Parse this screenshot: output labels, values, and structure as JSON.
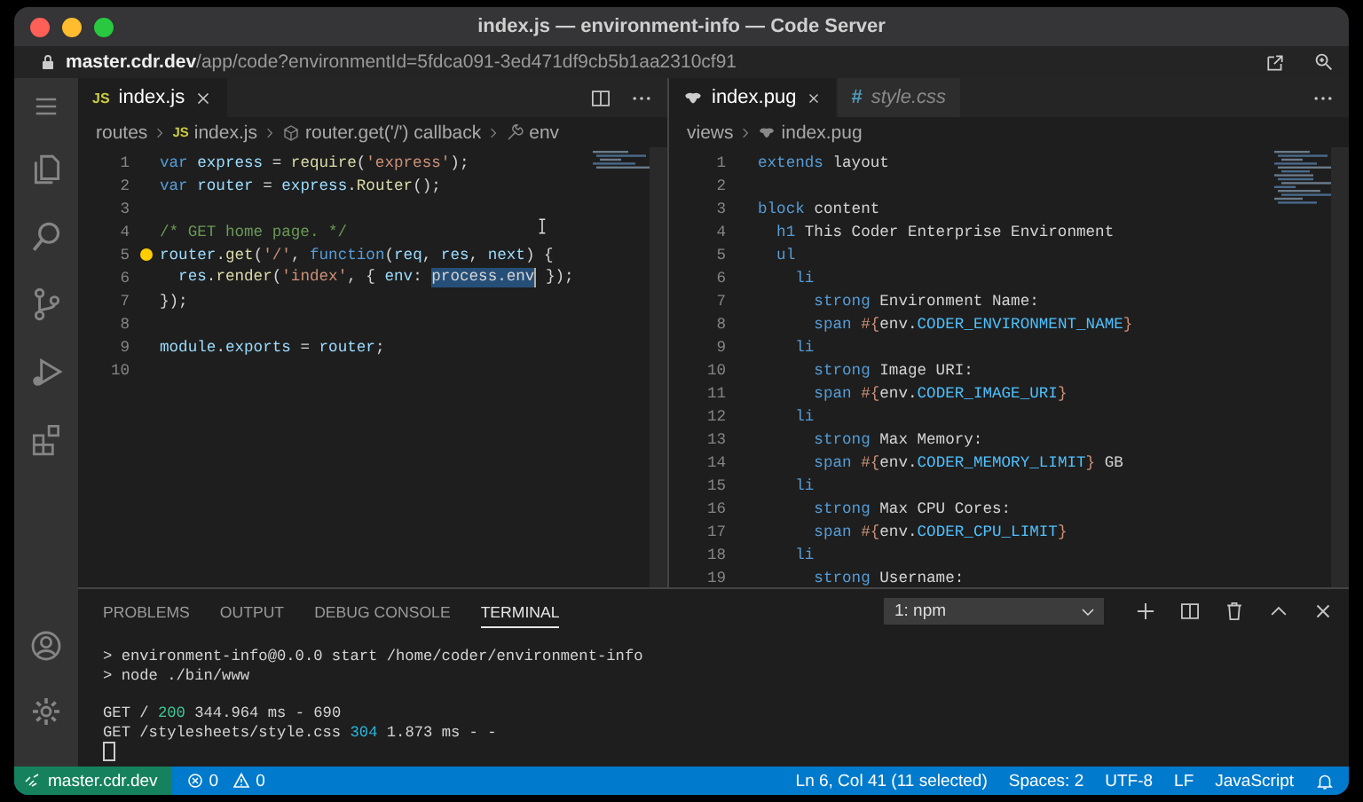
{
  "window": {
    "title": "index.js — environment-info — Code Server"
  },
  "address_bar": {
    "host": "master.cdr.dev",
    "path": "/app/code?environmentId=5fdca091-3ed471df9cb5b1aa2310cf91"
  },
  "editor_groups": [
    {
      "tabs": [
        {
          "label": "index.js",
          "icon_text": "JS",
          "kind": "js",
          "selected": true
        }
      ],
      "breadcrumbs": [
        {
          "label": "routes",
          "kind": "folder"
        },
        {
          "label": "index.js",
          "kind": "js",
          "icon_text": "JS"
        },
        {
          "label": "router.get('/') callback",
          "kind": "method"
        },
        {
          "label": "env",
          "kind": "field"
        }
      ],
      "lines": [
        {
          "number": "1",
          "lightbulb": false,
          "tokens": [
            {
              "text": "var ",
              "kind": "kw"
            },
            {
              "text": "express",
              "kind": "var"
            },
            {
              "text": " = ",
              "kind": "plain"
            },
            {
              "text": "require",
              "kind": "fn"
            },
            {
              "text": "(",
              "kind": "plain"
            },
            {
              "text": "'express'",
              "kind": "str"
            },
            {
              "text": ");",
              "kind": "plain"
            }
          ]
        },
        {
          "number": "2",
          "lightbulb": false,
          "tokens": [
            {
              "text": "var ",
              "kind": "kw"
            },
            {
              "text": "router",
              "kind": "var"
            },
            {
              "text": " = ",
              "kind": "plain"
            },
            {
              "text": "express",
              "kind": "var"
            },
            {
              "text": ".",
              "kind": "plain"
            },
            {
              "text": "Router",
              "kind": "fn"
            },
            {
              "text": "();",
              "kind": "plain"
            }
          ]
        },
        {
          "number": "3",
          "lightbulb": false
        },
        {
          "number": "4",
          "lightbulb": false,
          "tokens": [
            {
              "text": "/* GET home page. */",
              "kind": "comment"
            }
          ]
        },
        {
          "number": "5",
          "lightbulb": true,
          "tokens": [
            {
              "text": "router",
              "kind": "var"
            },
            {
              "text": ".",
              "kind": "plain"
            },
            {
              "text": "get",
              "kind": "fn"
            },
            {
              "text": "(",
              "kind": "plain"
            },
            {
              "text": "'/'",
              "kind": "str"
            },
            {
              "text": ", ",
              "kind": "plain"
            },
            {
              "text": "function",
              "kind": "kw"
            },
            {
              "text": "(",
              "kind": "plain"
            },
            {
              "text": "req",
              "kind": "var"
            },
            {
              "text": ", ",
              "kind": "plain"
            },
            {
              "text": "res",
              "kind": "var"
            },
            {
              "text": ", ",
              "kind": "plain"
            },
            {
              "text": "next",
              "kind": "var"
            },
            {
              "text": ") {",
              "kind": "plain"
            }
          ]
        },
        {
          "number": "6",
          "lightbulb": false,
          "tokens": [
            {
              "text": "  res",
              "kind": "var"
            },
            {
              "text": ".",
              "kind": "plain"
            },
            {
              "text": "render",
              "kind": "fn"
            },
            {
              "text": "(",
              "kind": "plain"
            },
            {
              "text": "'index'",
              "kind": "str"
            },
            {
              "text": ", { ",
              "kind": "plain"
            },
            {
              "text": "env",
              "kind": "var"
            },
            {
              "text": ": ",
              "kind": "plain"
            },
            {
              "text": "process.env",
              "kind": "selection"
            },
            {
              "text": " });",
              "kind": "plain"
            }
          ]
        },
        {
          "number": "7",
          "lightbulb": false,
          "tokens": [
            {
              "text": "});",
              "kind": "plain"
            }
          ]
        },
        {
          "number": "8",
          "lightbulb": false
        },
        {
          "number": "9",
          "lightbulb": false,
          "tokens": [
            {
              "text": "module",
              "kind": "var"
            },
            {
              "text": ".",
              "kind": "plain"
            },
            {
              "text": "exports",
              "kind": "var"
            },
            {
              "text": " = ",
              "kind": "plain"
            },
            {
              "text": "router",
              "kind": "var"
            },
            {
              "text": ";",
              "kind": "plain"
            }
          ]
        },
        {
          "number": "10",
          "lightbulb": false
        }
      ]
    },
    {
      "tabs": [
        {
          "label": "index.pug",
          "kind": "pug",
          "selected": true
        },
        {
          "label": "style.css",
          "icon_text": "#",
          "kind": "css",
          "selected": false
        }
      ],
      "breadcrumbs": [
        {
          "label": "views",
          "kind": "folder"
        },
        {
          "label": "index.pug",
          "kind": "pug"
        }
      ],
      "lines": [
        {
          "number": "1",
          "lightbulb": false,
          "tokens": [
            {
              "text": "extends ",
              "kind": "kw"
            },
            {
              "text": "layout",
              "kind": "plain"
            }
          ]
        },
        {
          "number": "2",
          "lightbulb": false
        },
        {
          "number": "3",
          "lightbulb": false,
          "tokens": [
            {
              "text": "block ",
              "kind": "kw"
            },
            {
              "text": "content",
              "kind": "plain"
            }
          ]
        },
        {
          "number": "4",
          "lightbulb": false,
          "tokens": [
            {
              "text": "  h1",
              "kind": "kw"
            },
            {
              "text": " This Coder Enterprise Environment",
              "kind": "plain"
            }
          ]
        },
        {
          "number": "5",
          "lightbulb": false,
          "tokens": [
            {
              "text": "  ul",
              "kind": "kw"
            }
          ]
        },
        {
          "number": "6",
          "lightbulb": false,
          "tokens": [
            {
              "text": "    li",
              "kind": "kw"
            }
          ]
        },
        {
          "number": "7",
          "lightbulb": false,
          "tokens": [
            {
              "text": "      strong",
              "kind": "kw"
            },
            {
              "text": " Environment Name:",
              "kind": "plain"
            }
          ]
        },
        {
          "number": "8",
          "lightbulb": false,
          "tokens": [
            {
              "text": "      span",
              "kind": "kw"
            },
            {
              "text": " #{",
              "kind": "str"
            },
            {
              "text": "env.",
              "kind": "plain"
            },
            {
              "text": "CODER_ENVIRONMENT_NAME",
              "kind": "const"
            },
            {
              "text": "}",
              "kind": "str"
            }
          ]
        },
        {
          "number": "9",
          "lightbulb": false,
          "tokens": [
            {
              "text": "    li",
              "kind": "kw"
            }
          ]
        },
        {
          "number": "10",
          "lightbulb": false,
          "tokens": [
            {
              "text": "      strong",
              "kind": "kw"
            },
            {
              "text": " Image URI:",
              "kind": "plain"
            }
          ]
        },
        {
          "number": "11",
          "lightbulb": false,
          "tokens": [
            {
              "text": "      span",
              "kind": "kw"
            },
            {
              "text": " #{",
              "kind": "str"
            },
            {
              "text": "env.",
              "kind": "plain"
            },
            {
              "text": "CODER_IMAGE_URI",
              "kind": "const"
            },
            {
              "text": "}",
              "kind": "str"
            }
          ]
        },
        {
          "number": "12",
          "lightbulb": false,
          "tokens": [
            {
              "text": "    li",
              "kind": "kw"
            }
          ]
        },
        {
          "number": "13",
          "lightbulb": false,
          "tokens": [
            {
              "text": "      strong",
              "kind": "kw"
            },
            {
              "text": " Max Memory:",
              "kind": "plain"
            }
          ]
        },
        {
          "number": "14",
          "lightbulb": false,
          "tokens": [
            {
              "text": "      span",
              "kind": "kw"
            },
            {
              "text": " #{",
              "kind": "str"
            },
            {
              "text": "env.",
              "kind": "plain"
            },
            {
              "text": "CODER_MEMORY_LIMIT",
              "kind": "const"
            },
            {
              "text": "}",
              "kind": "str"
            },
            {
              "text": " GB",
              "kind": "plain"
            }
          ]
        },
        {
          "number": "15",
          "lightbulb": false,
          "tokens": [
            {
              "text": "    li",
              "kind": "kw"
            }
          ]
        },
        {
          "number": "16",
          "lightbulb": false,
          "tokens": [
            {
              "text": "      strong",
              "kind": "kw"
            },
            {
              "text": " Max CPU Cores:",
              "kind": "plain"
            }
          ]
        },
        {
          "number": "17",
          "lightbulb": false,
          "tokens": [
            {
              "text": "      span",
              "kind": "kw"
            },
            {
              "text": " #{",
              "kind": "str"
            },
            {
              "text": "env.",
              "kind": "plain"
            },
            {
              "text": "CODER_CPU_LIMIT",
              "kind": "const"
            },
            {
              "text": "}",
              "kind": "str"
            }
          ]
        },
        {
          "number": "18",
          "lightbulb": false,
          "tokens": [
            {
              "text": "    li",
              "kind": "kw"
            }
          ]
        },
        {
          "number": "19",
          "lightbulb": false,
          "tokens": [
            {
              "text": "      strong",
              "kind": "kw"
            },
            {
              "text": " Username:",
              "kind": "plain"
            }
          ]
        }
      ]
    }
  ],
  "panel": {
    "tabs": [
      {
        "label": "PROBLEMS",
        "selected": false
      },
      {
        "label": "OUTPUT",
        "selected": false
      },
      {
        "label": "DEBUG CONSOLE",
        "selected": false
      },
      {
        "label": "TERMINAL",
        "selected": true
      }
    ],
    "terminal_select": "1: npm",
    "terminal": [
      {
        "kind": "output",
        "tokens": [
          {
            "text": "> environment-info@0.0.0 start /home/coder/environment-info",
            "kind": "plain"
          }
        ]
      },
      {
        "kind": "output",
        "tokens": [
          {
            "text": "> node ./bin/www",
            "kind": "plain"
          }
        ]
      },
      {
        "kind": "blank"
      },
      {
        "kind": "output",
        "tokens": [
          {
            "text": "GET / ",
            "kind": "plain"
          },
          {
            "text": "200",
            "kind": "ok"
          },
          {
            "text": " 344.964 ms - 690",
            "kind": "plain"
          }
        ]
      },
      {
        "kind": "output",
        "tokens": [
          {
            "text": "GET /stylesheets/style.css ",
            "kind": "plain"
          },
          {
            "text": "304",
            "kind": "cached"
          },
          {
            "text": " 1.873 ms - -",
            "kind": "plain"
          }
        ]
      },
      {
        "kind": "cursor"
      }
    ]
  },
  "status_bar": {
    "branch": "master.cdr.dev",
    "errors": "0",
    "warnings": "0",
    "items": [
      "Ln 6, Col 41 (11 selected)",
      "Spaces: 2",
      "UTF-8",
      "LF",
      "JavaScript"
    ]
  }
}
